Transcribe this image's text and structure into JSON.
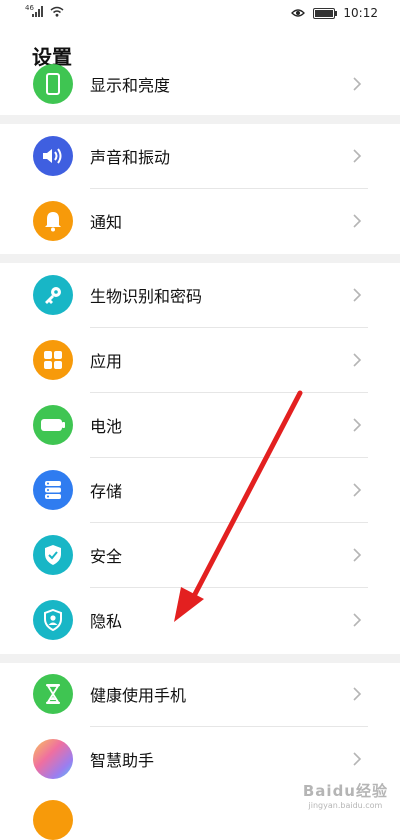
{
  "status_bar": {
    "signal_tag": "46",
    "time": "10:12",
    "icons": [
      "signal-icon",
      "wifi-icon",
      "eye-icon",
      "battery-icon"
    ]
  },
  "header": {
    "title": "设置"
  },
  "settings": {
    "items": [
      {
        "label": "显示和亮度",
        "icon": "display-icon",
        "color": "#3fc552"
      },
      {
        "label": "声音和振动",
        "icon": "speaker-icon",
        "color": "#3f5fe0"
      },
      {
        "label": "通知",
        "icon": "bell-icon",
        "color": "#f79a0a"
      },
      {
        "label": "生物识别和密码",
        "icon": "key-icon",
        "color": "#18b6c6"
      },
      {
        "label": "应用",
        "icon": "apps-grid-icon",
        "color": "#f79a0a"
      },
      {
        "label": "电池",
        "icon": "battery-setting-icon",
        "color": "#3fc552"
      },
      {
        "label": "存储",
        "icon": "storage-icon",
        "color": "#2f7cf0"
      },
      {
        "label": "安全",
        "icon": "shield-check-icon",
        "color": "#18b6c6"
      },
      {
        "label": "隐私",
        "icon": "privacy-icon",
        "color": "#18b6c6"
      },
      {
        "label": "健康使用手机",
        "icon": "hourglass-icon",
        "color": "#3fc552"
      },
      {
        "label": "智慧助手",
        "icon": "assistant-icon",
        "color": "#c57ae0"
      }
    ]
  },
  "annotation": {
    "arrow_color": "#e32020"
  },
  "watermark": {
    "main": "Baidu经验",
    "sub": "jingyan.baidu.com"
  }
}
